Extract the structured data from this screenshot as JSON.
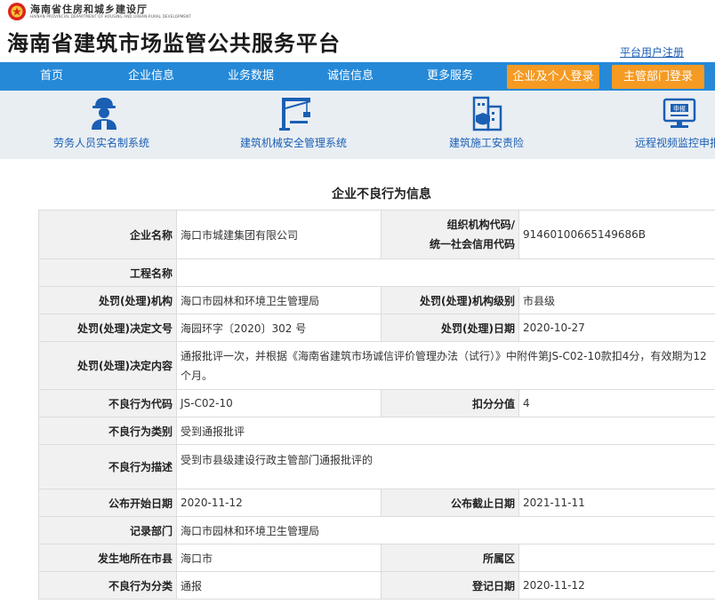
{
  "header": {
    "dept_cn": "海南省住房和城乡建设厅",
    "dept_en": "HAINAN PROVINCIAL DEPARTMENT OF HOUSING AND URBAN-RURAL DEVELOPMENT",
    "site_title": "海南省建筑市场监管公共服务平台",
    "register_link": "平台用户注册"
  },
  "nav": {
    "items": [
      "首页",
      "企业信息",
      "业务数据",
      "诚信信息",
      "更多服务"
    ],
    "login_enterprise": "企业及个人登录",
    "login_authority": "主管部门登录",
    "active_button_color": "#f59a23",
    "bar_color": "#2589d8"
  },
  "services": [
    {
      "label": "劳务人员实名制系统",
      "icon": "worker-icon"
    },
    {
      "label": "建筑机械安全管理系统",
      "icon": "crane-icon"
    },
    {
      "label": "建筑施工安责险",
      "icon": "insurance-building-icon"
    },
    {
      "label": "远程视频监控申报",
      "icon": "monitor-report-icon"
    }
  ],
  "page_title": "企业不良行为信息",
  "record": {
    "company_name_label": "企业名称",
    "company_name": "海口市城建集团有限公司",
    "org_code_label_1": "组织机构代码/",
    "org_code_label_2": "统一社会信用代码",
    "org_code": "91460100665149686B",
    "project_label": "工程名称",
    "project": "",
    "authority_label": "处罚(处理)机构",
    "authority": "海口市园林和环境卫生管理局",
    "authority_level_label": "处罚(处理)机构级别",
    "authority_level": "市县级",
    "doc_no_label": "处罚(处理)决定文号",
    "doc_no": "海园环字〔2020〕302 号",
    "decision_date_label": "处罚(处理)日期",
    "decision_date": "2020-10-27",
    "decision_content_label": "处罚(处理)决定内容",
    "decision_content": "通报批评一次，并根据《海南省建筑市场诚信评价管理办法（试行）》中附件第JS-C02-10款扣4分，有效期为12个月。",
    "behavior_code_label": "不良行为代码",
    "behavior_code": "JS-C02-10",
    "deduction_label": "扣分分值",
    "deduction": "4",
    "behavior_type_label": "不良行为类别",
    "behavior_type": "受到通报批评",
    "behavior_desc_label": "不良行为描述",
    "behavior_desc": "受到市县级建设行政主管部门通报批评的",
    "publish_start_label": "公布开始日期",
    "publish_start": "2020-11-12",
    "publish_end_label": "公布截止日期",
    "publish_end": "2021-11-11",
    "record_dept_label": "记录部门",
    "record_dept": "海口市园林和环境卫生管理局",
    "location_label": "发生地所在市县",
    "location": "海口市",
    "district_label": "所属区",
    "district": "",
    "category_label": "不良行为分类",
    "category": "通报",
    "register_date_label": "登记日期",
    "register_date": "2020-11-12"
  }
}
